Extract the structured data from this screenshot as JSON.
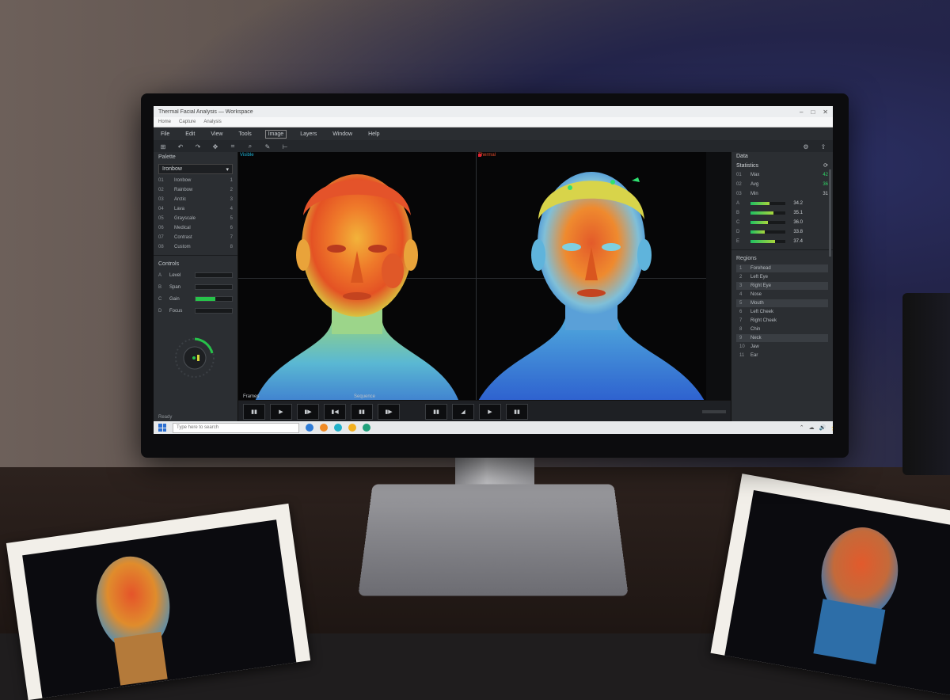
{
  "window": {
    "title": "Thermal Facial Analysis — Workspace",
    "controls": [
      "–",
      "□",
      "✕"
    ]
  },
  "addressbar": {
    "items": [
      "Home",
      "Capture",
      "Analysis"
    ]
  },
  "menu": {
    "items": [
      "File",
      "Edit",
      "View",
      "Tools",
      "Image",
      "Layers",
      "Window",
      "Help"
    ]
  },
  "toolbar": {
    "tools": [
      {
        "icon": "grid-icon",
        "glyph": "⊞"
      },
      {
        "icon": "undo-icon",
        "glyph": "↶"
      },
      {
        "icon": "redo-icon",
        "glyph": "↷"
      },
      {
        "icon": "move-icon",
        "glyph": "✥"
      },
      {
        "icon": "crop-icon",
        "glyph": "⌗"
      },
      {
        "icon": "zoom-icon",
        "glyph": "⌕"
      },
      {
        "icon": "brush-icon",
        "glyph": "✎"
      },
      {
        "icon": "measure-icon",
        "glyph": "⊢"
      }
    ],
    "right_tools": [
      {
        "icon": "settings-icon",
        "glyph": "⚙"
      },
      {
        "icon": "share-icon",
        "glyph": "⇪"
      }
    ]
  },
  "left_panel": {
    "title": "Palette",
    "dropdown": "Ironbow",
    "list": [
      {
        "k": "01",
        "label": "Ironbow",
        "v": "1"
      },
      {
        "k": "02",
        "label": "Rainbow",
        "v": "2"
      },
      {
        "k": "03",
        "label": "Arctic",
        "v": "3"
      },
      {
        "k": "04",
        "label": "Lava",
        "v": "4"
      },
      {
        "k": "05",
        "label": "Grayscale",
        "v": "5"
      },
      {
        "k": "06",
        "label": "Medical",
        "v": "6"
      },
      {
        "k": "07",
        "label": "Contrast",
        "v": "7"
      },
      {
        "k": "08",
        "label": "Custom",
        "v": "8"
      }
    ],
    "controls_title": "Controls",
    "controls": [
      {
        "k": "A",
        "label": "Level",
        "fill": 0
      },
      {
        "k": "B",
        "label": "Span",
        "fill": 0
      },
      {
        "k": "C",
        "label": "Gain",
        "fill": 0.55
      },
      {
        "k": "D",
        "label": "Focus",
        "fill": 0
      }
    ],
    "footer": "Ready"
  },
  "viewports": {
    "left_label": "Visible",
    "right_label": "Thermal"
  },
  "filmstrip": {
    "label_a": "Frames",
    "label_b": "Sequence",
    "thumbs_a": [
      "▮▮",
      "▶",
      "▮▶",
      "▮◀",
      "▮▮",
      "▮▶"
    ],
    "thumbs_b": [
      "▮▮",
      "◢",
      "▶",
      "▮▮"
    ]
  },
  "right_panel": {
    "title": "Data",
    "subtitle": "Statistics",
    "readouts": [
      {
        "k": "01",
        "label": "Max",
        "val": "42",
        "green": true
      },
      {
        "k": "02",
        "label": "Avg",
        "val": "36",
        "green": true
      },
      {
        "k": "03",
        "label": "Min",
        "val": "31",
        "green": false
      }
    ],
    "meters": [
      {
        "k": "A",
        "val": "34.2",
        "fill": 0.55
      },
      {
        "k": "B",
        "val": "35.1",
        "fill": 0.65
      },
      {
        "k": "C",
        "val": "36.0",
        "fill": 0.5
      },
      {
        "k": "D",
        "val": "33.8",
        "fill": 0.4
      },
      {
        "k": "E",
        "val": "37.4",
        "fill": 0.7
      }
    ],
    "list_title": "Regions",
    "list": [
      {
        "k": "1",
        "label": "Forehead",
        "hl": true
      },
      {
        "k": "2",
        "label": "Left Eye",
        "hl": false
      },
      {
        "k": "3",
        "label": "Right Eye",
        "hl": true
      },
      {
        "k": "4",
        "label": "Nose",
        "hl": false
      },
      {
        "k": "5",
        "label": "Mouth",
        "hl": true
      },
      {
        "k": "6",
        "label": "Left Cheek",
        "hl": false
      },
      {
        "k": "7",
        "label": "Right Cheek",
        "hl": false
      },
      {
        "k": "8",
        "label": "Chin",
        "hl": false
      },
      {
        "k": "9",
        "label": "Neck",
        "hl": true
      },
      {
        "k": "10",
        "label": "Jaw",
        "hl": false
      },
      {
        "k": "11",
        "label": "Ear",
        "hl": false
      }
    ]
  },
  "taskbar": {
    "search_placeholder": "Type here to search",
    "apps": [
      {
        "icon": "folder-icon",
        "color": "#2e7bd6"
      },
      {
        "icon": "browser-icon",
        "color": "#f08a24"
      },
      {
        "icon": "store-icon",
        "color": "#21b0c8"
      },
      {
        "icon": "photo-icon",
        "color": "#f2b01e"
      },
      {
        "icon": "edge-icon",
        "color": "#1fa07a"
      }
    ],
    "tray": [
      "⌃",
      "☁",
      "🔊",
      "⚡"
    ]
  },
  "colors": {
    "accent_green": "#30d466",
    "panel_bg": "#2b2e32",
    "viewport_bg": "#060607"
  }
}
